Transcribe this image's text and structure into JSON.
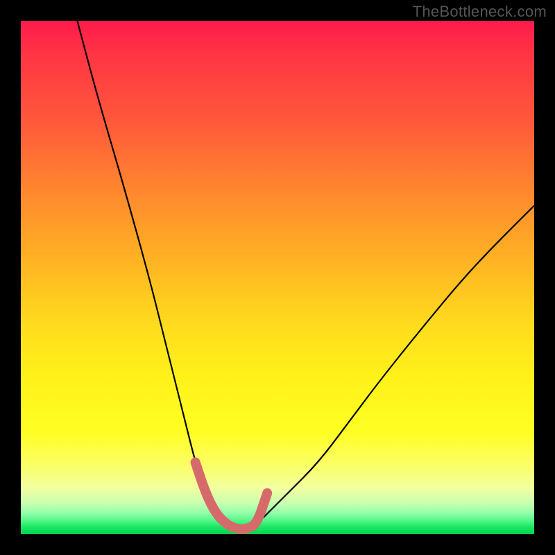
{
  "watermark": "TheBottleneck.com",
  "chart_data": {
    "type": "line",
    "title": "",
    "xlabel": "",
    "ylabel": "",
    "xlim": [
      0,
      100
    ],
    "ylim": [
      0,
      100
    ],
    "series": [
      {
        "name": "bottleneck-curve",
        "x": [
          11,
          15,
          20,
          25,
          28,
          30,
          32,
          34,
          36,
          38,
          40,
          42,
          44,
          46,
          48,
          52,
          58,
          64,
          70,
          78,
          88,
          100
        ],
        "values": [
          100,
          85,
          68,
          50,
          38,
          30,
          22,
          14,
          8,
          4,
          2,
          1,
          1,
          2,
          4,
          8,
          14,
          22,
          30,
          40,
          52,
          64
        ]
      }
    ],
    "annotations": [
      {
        "name": "trough-highlight",
        "type": "thick-segment",
        "color": "#d66a6a",
        "x": [
          34,
          36,
          38,
          40,
          42,
          44,
          46,
          48
        ],
        "values": [
          14,
          8,
          4,
          2,
          1,
          1,
          2,
          8
        ]
      }
    ]
  }
}
